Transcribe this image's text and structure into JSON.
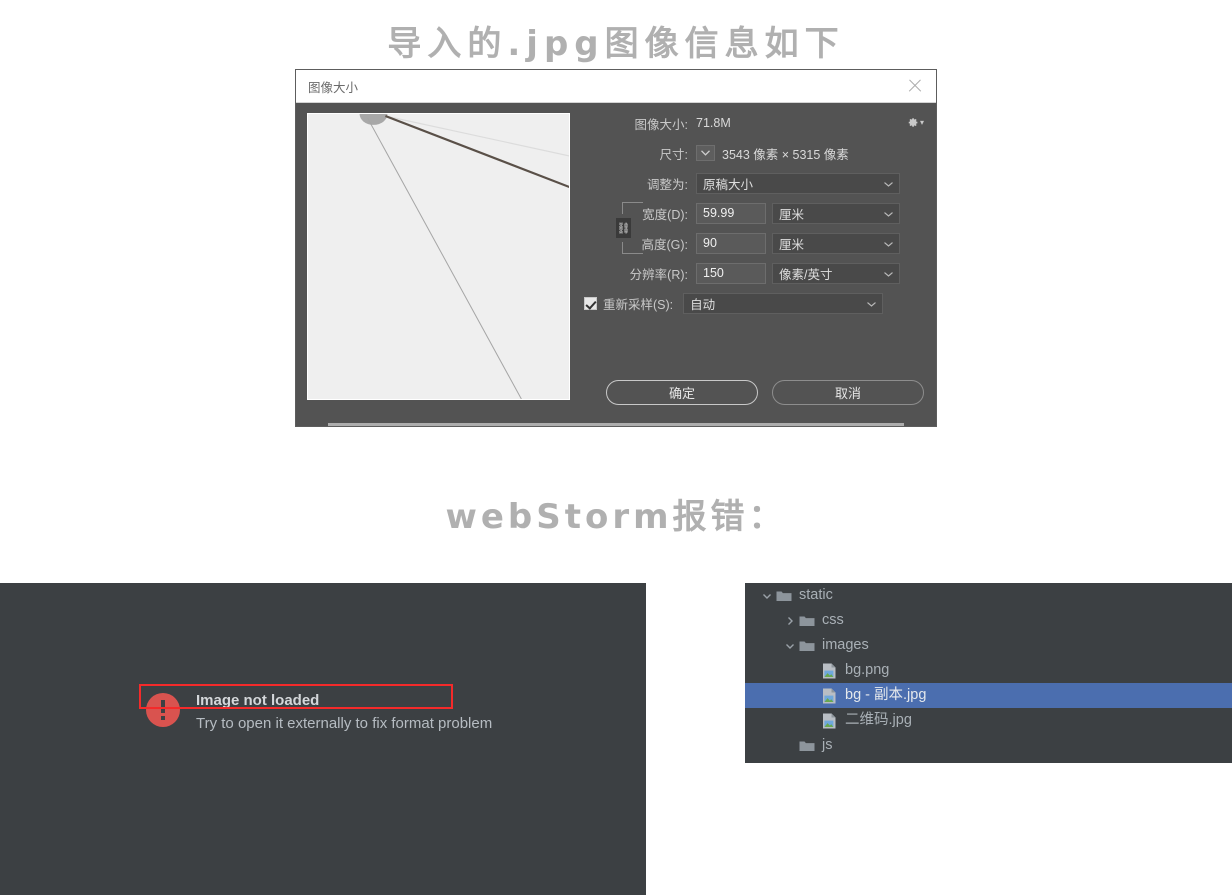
{
  "headings": {
    "top": "导入的.jpg图像信息如下",
    "middle": "webStorm报错："
  },
  "ps_dialog": {
    "title": "图像大小",
    "close_icon": "close-icon",
    "gear_icon": "gear-icon",
    "image_size_label": "图像大小:",
    "image_size_value": "71.8M",
    "dimensions_label": "尺寸:",
    "dimensions_value": "3543 像素 × 5315 像素",
    "fit_to_label": "调整为:",
    "fit_to_value": "原稿大小",
    "width_label": "宽度(D):",
    "width_value": "59.99",
    "width_unit": "厘米",
    "height_label": "高度(G):",
    "height_value": "90",
    "height_unit": "厘米",
    "resolution_label": "分辨率(R):",
    "resolution_value": "150",
    "resolution_unit": "像素/英寸",
    "resample_label": "重新采样(S):",
    "resample_value": "自动",
    "resample_checked": true,
    "ok_button": "确定",
    "cancel_button": "取消",
    "link_icon": "chain-link-icon"
  },
  "error_panel": {
    "icon": "error-circle-icon",
    "title": "Image not loaded",
    "subtitle": "Try to open it externally to fix format problem",
    "accent_color": "#d9534f",
    "background_color": "#3c4043"
  },
  "tree_panel": {
    "background_color": "#3c4043",
    "selection_color": "#4b6eaf",
    "annotation_color": "#f42a2a",
    "rows": [
      {
        "label": "static",
        "type": "folder",
        "chevron": "chevron-down",
        "indent": 0,
        "selected": false
      },
      {
        "label": "css",
        "type": "folder",
        "chevron": "chevron-right",
        "indent": 1,
        "selected": false
      },
      {
        "label": "images",
        "type": "folder",
        "chevron": "chevron-down",
        "indent": 1,
        "selected": false
      },
      {
        "label": "bg.png",
        "type": "image",
        "chevron": "none",
        "indent": 2,
        "selected": false
      },
      {
        "label": "bg - 副本.jpg",
        "type": "image",
        "chevron": "none",
        "indent": 2,
        "selected": true
      },
      {
        "label": "二维码.jpg",
        "type": "image",
        "chevron": "none",
        "indent": 2,
        "selected": false
      },
      {
        "label": "js",
        "type": "folder",
        "chevron": "none",
        "indent": 1,
        "selected": false
      }
    ]
  }
}
